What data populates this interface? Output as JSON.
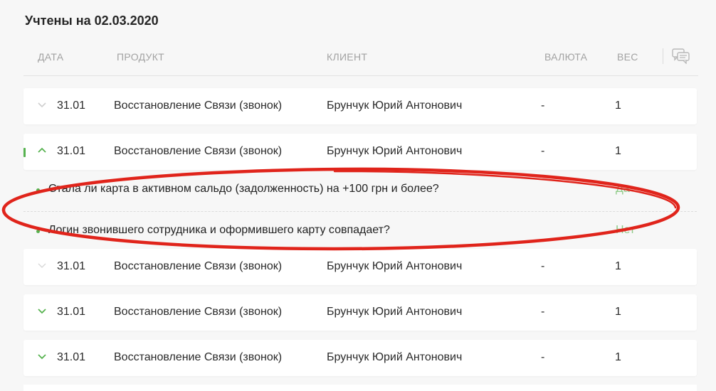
{
  "page": {
    "title": "Учтены на 02.03.2020"
  },
  "table": {
    "headers": {
      "date": "ДАТА",
      "product": "ПРОДУКТ",
      "client": "КЛИЕНТ",
      "currency": "ВАЛЮТА",
      "weight": "ВЕС"
    },
    "comment_icon": "chat-bubbles-icon",
    "rows": [
      {
        "date": "31.01",
        "product": "Восстановление Связи (звонок)",
        "client": "Брунчук Юрий Антонович",
        "currency": "-",
        "weight": "1",
        "chevron": "chevron-down-icon"
      },
      {
        "date": "31.01",
        "product": "Восстановление Связи (звонок)",
        "client": "Брунчук Юрий Антонович",
        "currency": "-",
        "weight": "1",
        "chevron": "chevron-up-icon",
        "expanded": true
      },
      {
        "date": "31.01",
        "product": "Восстановление Связи (звонок)",
        "client": "Брунчук Юрий Антонович",
        "currency": "-",
        "weight": "1",
        "chevron": "chevron-down-icon"
      },
      {
        "date": "31.01",
        "product": "Восстановление Связи (звонок)",
        "client": "Брунчук Юрий Антонович",
        "currency": "-",
        "weight": "1",
        "chevron": "chevron-down-icon"
      },
      {
        "date": "31.01",
        "product": "Восстановление Связи (звонок)",
        "client": "Брунчук Юрий Антонович",
        "currency": "-",
        "weight": "1",
        "chevron": "chevron-down-icon"
      }
    ],
    "details": [
      {
        "question": "Стала ли карта в активном сальдо (задолженность) на +100 грн и более?",
        "answer": "Да"
      },
      {
        "question": "Логин звонившего сотрудника и оформившего карту совпадает?",
        "answer": "Нет"
      }
    ]
  },
  "colors": {
    "accent": "#56b24f",
    "annotation": "#e0241b",
    "background": "#f7f7f7"
  }
}
